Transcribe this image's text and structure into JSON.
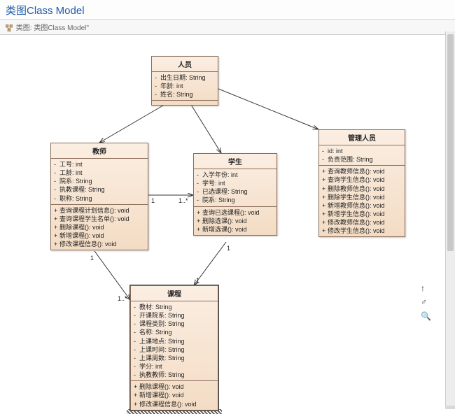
{
  "page": {
    "title": "类图Class Model",
    "tab_label": "类图: 类图Class Model\""
  },
  "classes": {
    "person": {
      "name": "人员",
      "attrs": [
        {
          "vis": "-",
          "text": "出生日期: String"
        },
        {
          "vis": "-",
          "text": "年龄: int"
        },
        {
          "vis": "-",
          "text": "姓名: String"
        }
      ],
      "ops": []
    },
    "teacher": {
      "name": "教师",
      "attrs": [
        {
          "vis": "-",
          "text": "工号: int"
        },
        {
          "vis": "-",
          "text": "工龄: int"
        },
        {
          "vis": "-",
          "text": "院系: String"
        },
        {
          "vis": "-",
          "text": "执教课程: String"
        },
        {
          "vis": "-",
          "text": "职称: String"
        }
      ],
      "ops": [
        {
          "vis": "+",
          "text": "查询课程计划信息(): void"
        },
        {
          "vis": "+",
          "text": "查询课程学生名单(): void"
        },
        {
          "vis": "+",
          "text": "删除课程(): void"
        },
        {
          "vis": "+",
          "text": "新增课程(): void"
        },
        {
          "vis": "+",
          "text": "修改课程信息(): void"
        }
      ]
    },
    "student": {
      "name": "学生",
      "attrs": [
        {
          "vis": "-",
          "text": "入学年份: int"
        },
        {
          "vis": "-",
          "text": "学号: int"
        },
        {
          "vis": "-",
          "text": "已选课程: String"
        },
        {
          "vis": "-",
          "text": "院系: String"
        }
      ],
      "ops": [
        {
          "vis": "+",
          "text": "查询已选课程(): void"
        },
        {
          "vis": "+",
          "text": "删除选课(): void"
        },
        {
          "vis": "+",
          "text": "新增选课(): void"
        }
      ]
    },
    "admin": {
      "name": "管理人员",
      "attrs": [
        {
          "vis": "-",
          "text": "id: int"
        },
        {
          "vis": "-",
          "text": "负责范围: String"
        }
      ],
      "ops": [
        {
          "vis": "+",
          "text": "查询教师信息(): void"
        },
        {
          "vis": "+",
          "text": "查询学生信息(): void"
        },
        {
          "vis": "+",
          "text": "删除教师信息(): void"
        },
        {
          "vis": "+",
          "text": "删除学生信息(): void"
        },
        {
          "vis": "+",
          "text": "新增教师信息(): void"
        },
        {
          "vis": "+",
          "text": "新增学生信息(): void"
        },
        {
          "vis": "+",
          "text": "修改教师信息(): void"
        },
        {
          "vis": "+",
          "text": "修改学生信息(): void"
        }
      ]
    },
    "course": {
      "name": "课程",
      "attrs": [
        {
          "vis": "-",
          "text": "教材: String"
        },
        {
          "vis": "-",
          "text": "开课院系: String"
        },
        {
          "vis": "-",
          "text": "课程类别: String"
        },
        {
          "vis": "-",
          "text": "名称: String"
        },
        {
          "vis": "-",
          "text": "上课地点: String"
        },
        {
          "vis": "-",
          "text": "上课时间: String"
        },
        {
          "vis": "-",
          "text": "上课周数: String"
        },
        {
          "vis": "-",
          "text": "学分: int"
        },
        {
          "vis": "-",
          "text": "执教教师: String"
        }
      ],
      "ops": [
        {
          "vis": "+",
          "text": "删除课程(): void"
        },
        {
          "vis": "+",
          "text": "新增课程(): void"
        },
        {
          "vis": "+",
          "text": "修改课程信息(): void"
        }
      ]
    }
  },
  "multiplicities": {
    "m1": "1",
    "m2": "1..*",
    "m3": "1",
    "m4": "1",
    "m5": "1..*",
    "m6": "1"
  },
  "tools": {
    "up_down": "↕",
    "link": "⚭",
    "zoom": "🔍"
  }
}
